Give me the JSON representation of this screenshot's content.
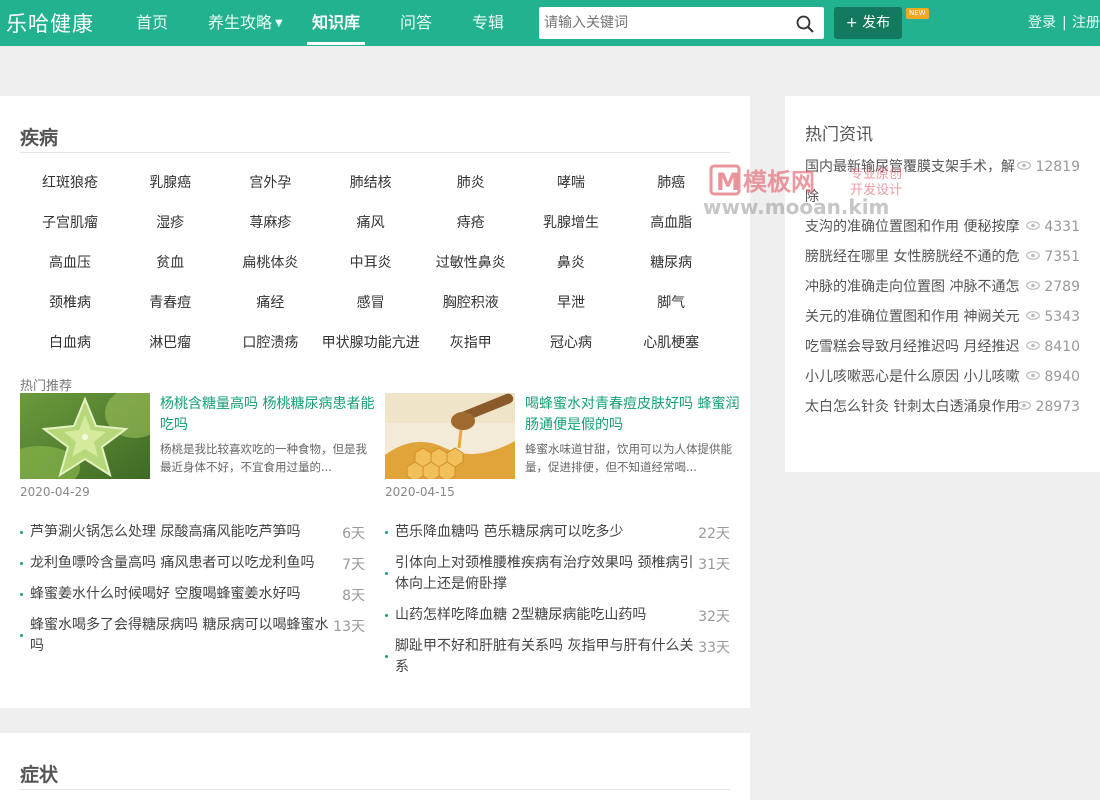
{
  "header": {
    "logo": "乐哈健康",
    "nav": [
      {
        "label": "首页"
      },
      {
        "label": "养生攻略",
        "has_dropdown": true
      },
      {
        "label": "知识库",
        "active": true
      },
      {
        "label": "问答"
      },
      {
        "label": "专辑"
      }
    ],
    "search_placeholder": "请输入关键词",
    "publish_label": "+ 发布",
    "new_badge": "NEW",
    "login": "登录",
    "separator": "|",
    "register": "注册"
  },
  "disease": {
    "title": "疾病",
    "tags": [
      "红斑狼疮",
      "乳腺癌",
      "宫外孕",
      "肺结核",
      "肺炎",
      "哮喘",
      "肺癌",
      "子宫肌瘤",
      "湿疹",
      "荨麻疹",
      "痛风",
      "痔疮",
      "乳腺增生",
      "高血脂",
      "高血压",
      "贫血",
      "扁桃体炎",
      "中耳炎",
      "过敏性鼻炎",
      "鼻炎",
      "糖尿病",
      "颈椎病",
      "青春痘",
      "痛经",
      "感冒",
      "胸腔积液",
      "早泄",
      "脚气",
      "白血病",
      "淋巴瘤",
      "口腔溃疡",
      "甲状腺功能亢进",
      "灰指甲",
      "冠心病",
      "心肌梗塞"
    ],
    "recommend_label": "热门推荐",
    "cards": [
      {
        "title": "杨桃含糖量高吗 杨桃糖尿病患者能吃吗",
        "desc": "杨桃是我比较喜欢吃的一种食物，但是我最近身体不好，不宜食用过量的...",
        "date": "2020-04-29",
        "image": "starfruit"
      },
      {
        "title": "喝蜂蜜水对青春痘皮肤好吗 蜂蜜润肠通便是假的吗",
        "desc": "蜂蜜水味道甘甜，饮用可以为人体提供能量，促进排便，但不知道经常喝...",
        "date": "2020-04-15",
        "image": "honey"
      }
    ],
    "news_left": [
      {
        "text": "芦笋涮火锅怎么处理 尿酸高痛风能吃芦笋吗",
        "days": "6天"
      },
      {
        "text": "龙利鱼嘌呤含量高吗 痛风患者可以吃龙利鱼吗",
        "days": "7天"
      },
      {
        "text": "蜂蜜姜水什么时候喝好 空腹喝蜂蜜姜水好吗",
        "days": "8天"
      },
      {
        "text": "蜂蜜水喝多了会得糖尿病吗 糖尿病可以喝蜂蜜水吗",
        "days": "13天"
      }
    ],
    "news_right": [
      {
        "text": "芭乐降血糖吗 芭乐糖尿病可以吃多少",
        "days": "22天"
      },
      {
        "text": "引体向上对颈椎腰椎疾病有治疗效果吗 颈椎病引体向上还是俯卧撑",
        "days": "31天"
      },
      {
        "text": "山药怎样吃降血糖 2型糖尿病能吃山药吗",
        "days": "32天"
      },
      {
        "text": "脚趾甲不好和肝脏有关系吗 灰指甲与肝有什么关系",
        "days": "33天"
      }
    ]
  },
  "hot_news": {
    "title": "热门资讯",
    "items": [
      {
        "text": "国内最新输尿管覆膜支架手术，解除",
        "views": "12819"
      },
      {
        "text": "支沟的准确位置图和作用 便秘按摩",
        "views": "4331"
      },
      {
        "text": "膀胱经在哪里 女性膀胱经不通的危",
        "views": "7351"
      },
      {
        "text": "冲脉的准确走向位置图 冲脉不通怎",
        "views": "2789"
      },
      {
        "text": "关元的准确位置图和作用 神阙关元",
        "views": "5343"
      },
      {
        "text": "吃雪糕会导致月经推迟吗 月经推迟",
        "views": "8410"
      },
      {
        "text": "小儿咳嗽恶心是什么原因 小儿咳嗽",
        "views": "8940"
      },
      {
        "text": "太白怎么针灸 针刺太白透涌泉作用",
        "views": "28973"
      }
    ]
  },
  "symptom": {
    "title": "症状"
  },
  "watermark": {
    "brand": "模板网",
    "sub1": "专业原创",
    "sub2": "开发设计",
    "url": "www.mooan.kim"
  },
  "colors": {
    "primary": "#22b290",
    "publish": "#137a5f",
    "link": "#15a07a",
    "badge": "#f5a623"
  }
}
